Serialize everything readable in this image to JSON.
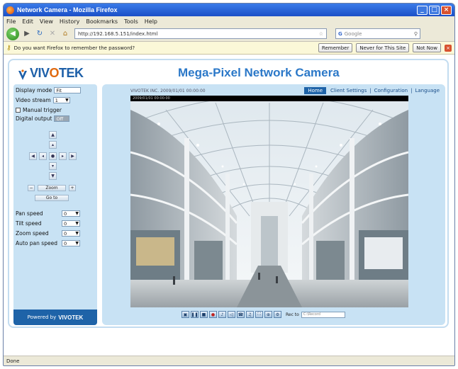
{
  "window": {
    "title": "Network Camera - Mozilla Firefox",
    "controls": {
      "minimize": "_",
      "maximize": "□",
      "close": "×"
    }
  },
  "menu": [
    "File",
    "Edit",
    "View",
    "History",
    "Bookmarks",
    "Tools",
    "Help"
  ],
  "nav": {
    "url": "http://192.168.5.151/index.html",
    "search_engine": "G",
    "search_placeholder": "Google",
    "icons": [
      "back-arrow-icon",
      "forward-arrow-icon",
      "reload-icon",
      "stop-icon",
      "home-icon"
    ]
  },
  "notification": {
    "message": "Do you want Firefox to remember the password?",
    "buttons": [
      "Remember",
      "Never for This Site",
      "Not Now"
    ],
    "close": "×"
  },
  "page": {
    "brand": {
      "pre": "VIV",
      "o": "O",
      "post": "TEK"
    },
    "title": "Mega-Pixel Network Camera",
    "topnav": {
      "active": "Home",
      "items": [
        "Client Settings",
        "Configuration",
        "Language"
      ]
    },
    "video_header": "VIVOTEK INC.  2009/01/01 00:00:00",
    "video_overlay": "2009/01/01 00:00:00"
  },
  "left_panel": {
    "display_mode_label": "Display mode",
    "display_mode_value": "Fit",
    "video_stream_label": "Video stream",
    "video_stream_value": "1",
    "manual_trigger_label": "Manual trigger",
    "digital_output_label": "Digital output",
    "digital_output_value": "Off",
    "ptz_center": "●",
    "zoom_out_label": "−",
    "zoom_label": "Zoom",
    "zoom_in_label": "+",
    "preset_button": "Go to",
    "pan_speed_label": "Pan speed",
    "pan_speed_value": "0",
    "tilt_speed_label": "Tilt speed",
    "tilt_speed_value": "0",
    "zoom_speed_label": "Zoom speed",
    "zoom_speed_value": "0",
    "auto_pan_speed_label": "Auto pan speed",
    "auto_pan_speed_value": "0",
    "powered_by": "Powered by",
    "powered_brand": "VIVOTEK"
  },
  "controls_bar": {
    "icons": [
      "snapshot-icon",
      "pause-icon",
      "stop-icon",
      "record-icon",
      "volume-icon",
      "mute-icon",
      "talk-icon",
      "mic-icon",
      "fullscreen-icon",
      "zoom-icon",
      "settings-icon"
    ],
    "glyphs": [
      "▣",
      "❚❚",
      "■",
      "●",
      "♪",
      "◁",
      "☎",
      "♫",
      "⛶",
      "⊕",
      "⚙"
    ],
    "record_label": "Rec to",
    "record_path": "C:\\Record"
  },
  "status": {
    "text": "Done"
  },
  "colors": {
    "brand_blue": "#1d5fa8",
    "accent_orange": "#e06a10",
    "panel_blue": "#c8e2f4",
    "title_blue": "#2b78c8"
  }
}
